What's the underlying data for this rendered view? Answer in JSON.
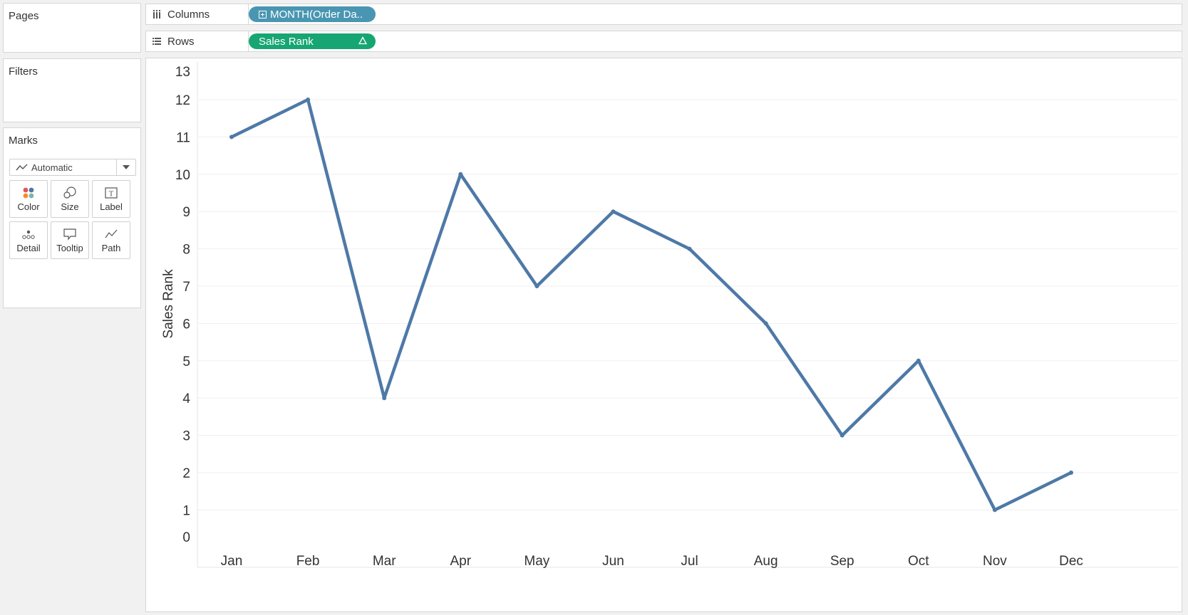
{
  "sidebar": {
    "pages_title": "Pages",
    "filters_title": "Filters",
    "marks": {
      "title": "Marks",
      "mark_type": "Automatic",
      "buttons": [
        {
          "label": "Color",
          "icon": "color-icon"
        },
        {
          "label": "Size",
          "icon": "size-icon"
        },
        {
          "label": "Label",
          "icon": "label-icon"
        },
        {
          "label": "Detail",
          "icon": "detail-icon"
        },
        {
          "label": "Tooltip",
          "icon": "tooltip-icon"
        },
        {
          "label": "Path",
          "icon": "path-icon"
        }
      ]
    }
  },
  "shelves": {
    "columns": {
      "label": "Columns",
      "pill": "MONTH(Order Da..",
      "pill_color": "#4996b2"
    },
    "rows": {
      "label": "Rows",
      "pill": "Sales Rank",
      "pill_color": "#17a673"
    }
  },
  "chart_data": {
    "type": "line",
    "categories": [
      "Jan",
      "Feb",
      "Mar",
      "Apr",
      "May",
      "Jun",
      "Jul",
      "Aug",
      "Sep",
      "Oct",
      "Nov",
      "Dec"
    ],
    "values": [
      11,
      12,
      4,
      10,
      7,
      9,
      8,
      6,
      3,
      5,
      1,
      2
    ],
    "ylabel": "Sales Rank",
    "xlabel": "",
    "ylim": [
      0,
      13
    ],
    "yticks": [
      0,
      1,
      2,
      3,
      4,
      5,
      6,
      7,
      8,
      9,
      10,
      11,
      12,
      13
    ],
    "line_color": "#4e79a7",
    "grid": true
  }
}
